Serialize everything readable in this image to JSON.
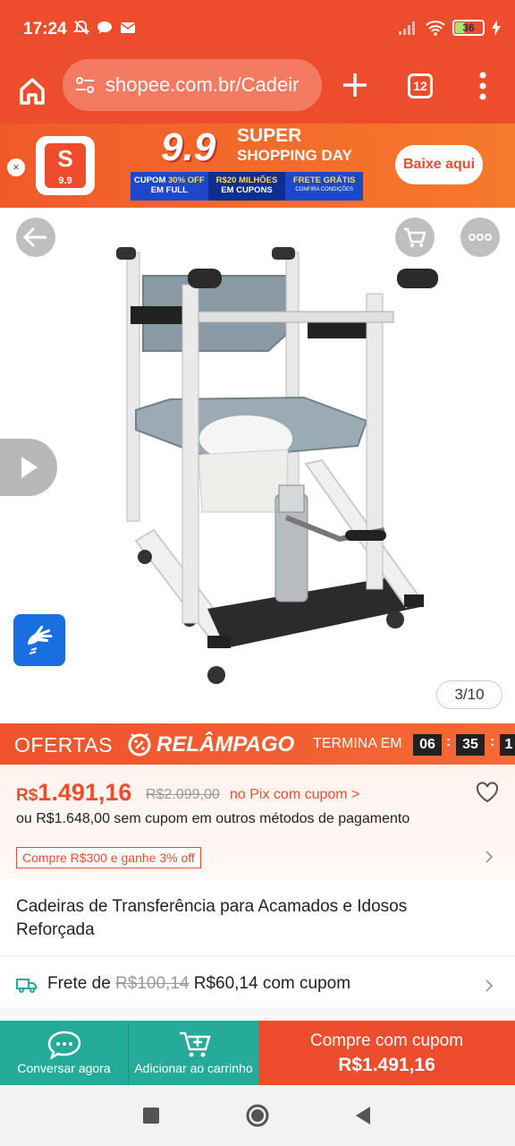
{
  "status_bar": {
    "time": "17:24",
    "battery": "36",
    "battery_level": 0.36
  },
  "browser": {
    "url": "shopee.com.br/Cadeir",
    "tab_count": "12"
  },
  "promo_banner": {
    "logo_label": "9.9",
    "headline_number": "9.9",
    "headline_1": "SUPER",
    "headline_2": "SHOPPING DAY",
    "strip": [
      {
        "line1_a": "CUPOM ",
        "line1_b": "30% OFF",
        "line2": "EM FULL"
      },
      {
        "line1_a": "R$",
        "line1_b": "20 MILHÕES",
        "line2": "EM CUPONS"
      },
      {
        "line1_a": "",
        "line1_b": "FRETE GRÁTIS",
        "line2": "CONFIRA CONDIÇÕES"
      }
    ],
    "cta": "Baixe aqui",
    "close": "×"
  },
  "gallery": {
    "counter": "3/10"
  },
  "flash_sale": {
    "ofertas": "OFERTAS",
    "relampago": "RELÂMPAGO",
    "termina": "TERMINA EM",
    "hours": "06",
    "minutes": "35",
    "seconds": "1"
  },
  "price": {
    "currency": "R$",
    "value": "1.491,16",
    "old_price": "R$2.099,00",
    "pix_note": "no Pix com cupom >",
    "alt_text": "ou R$1.648,00 sem cupom em outros métodos de pagamento",
    "voucher": "Compre R$300 e ganhe 3% off"
  },
  "product": {
    "title": "Cadeiras de Transferência para Acamados e Idosos Reforçada"
  },
  "shipping": {
    "prefix": "Frete de ",
    "old": "R$100,14",
    "new": " R$60,14 com cupom"
  },
  "bottom_bar": {
    "chat_label": "Conversar agora",
    "cart_label": "Adicionar ao carrinho",
    "buy_title": "Compre com cupom",
    "buy_price": "R$1.491,16"
  },
  "colors": {
    "brand": "#ee4d2d",
    "teal": "#26aa99",
    "a11y_blue": "#1a6fe0"
  }
}
